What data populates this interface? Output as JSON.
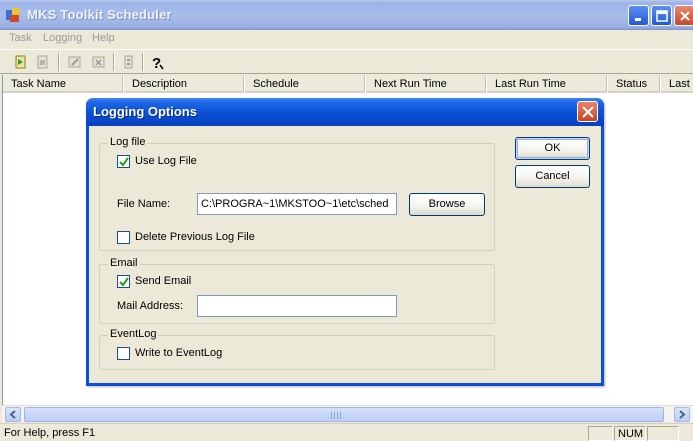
{
  "app": {
    "title": "MKS Toolkit Scheduler"
  },
  "menu": {
    "items": [
      "Task",
      "Logging",
      "Help"
    ]
  },
  "toolbar": {
    "icons": [
      "run-task-icon",
      "stop-task-icon",
      "edit-task-icon",
      "delete-task-icon",
      "properties-icon",
      "help-icon"
    ]
  },
  "table": {
    "columns": [
      "Task Name",
      "Description",
      "Schedule",
      "Next Run Time",
      "Last Run Time",
      "Status",
      "Last R"
    ]
  },
  "statusbar": {
    "text": "For Help, press F1",
    "num": "NUM"
  },
  "dialog": {
    "title": "Logging Options",
    "ok_label": "OK",
    "cancel_label": "Cancel",
    "logfile": {
      "group_title": "Log file",
      "use_log_label": "Use Log File",
      "use_log_checked": true,
      "file_name_label": "File Name:",
      "file_name_value": "C:\\PROGRA~1\\MKSTOO~1\\etc\\sched",
      "browse_label": "Browse",
      "delete_prev_label": "Delete Previous Log File",
      "delete_prev_checked": false
    },
    "email": {
      "group_title": "Email",
      "send_email_label": "Send Email",
      "send_email_checked": true,
      "mail_address_label": "Mail Address:",
      "mail_address_value": ""
    },
    "eventlog": {
      "group_title": "EventLog",
      "write_label": "Write to EventLog",
      "write_checked": false
    }
  },
  "colors": {
    "dialog_title": "#0a53d8",
    "window_title": "#9db3e6",
    "face": "#ece9d8"
  }
}
